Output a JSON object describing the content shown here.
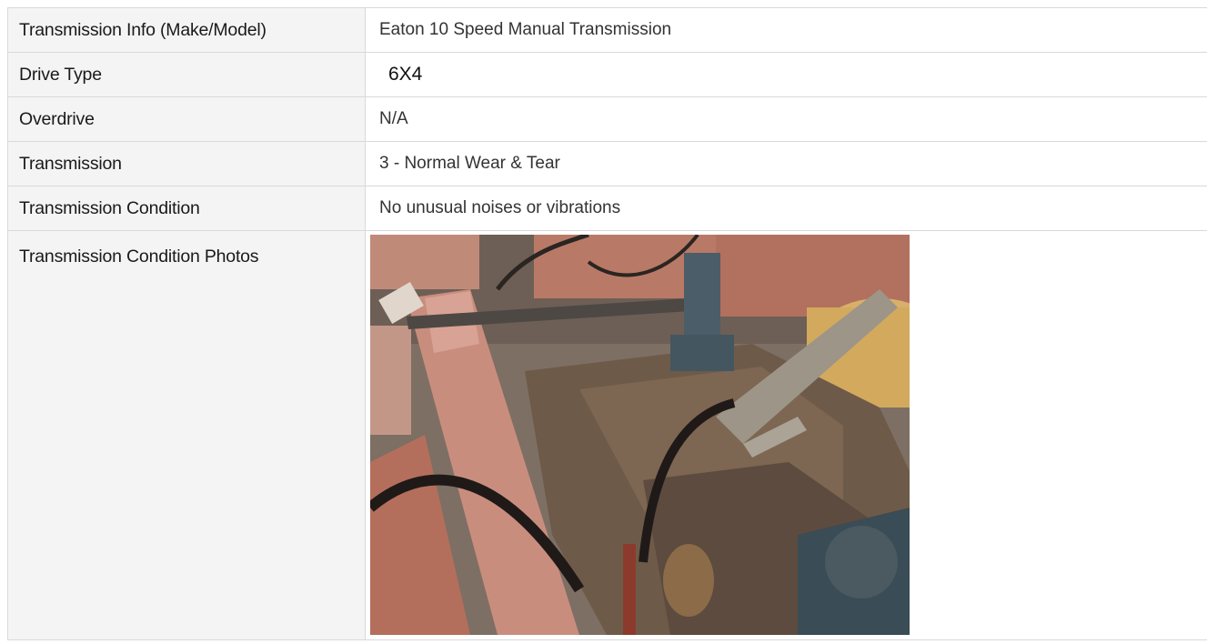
{
  "rows": [
    {
      "label": "Transmission Info (Make/Model)",
      "value": "Eaton 10 Speed Manual Transmission"
    },
    {
      "label": "Drive Type",
      "value": "6X4"
    },
    {
      "label": "Overdrive",
      "value": "N/A"
    },
    {
      "label": "Transmission",
      "value": "3 - Normal Wear & Tear"
    },
    {
      "label": "Transmission Condition",
      "value": "No unusual noises or vibrations"
    },
    {
      "label": "Transmission Condition Photos"
    }
  ],
  "photo": {
    "description_icon": "transmission-photo",
    "colors": {
      "frame_rail": "#c98d7e",
      "housing": "#6e5a48",
      "cable": "#1f1a18",
      "branch": "#9c9588",
      "tank": "#d8b06a",
      "background": "#8a7a6c"
    }
  }
}
